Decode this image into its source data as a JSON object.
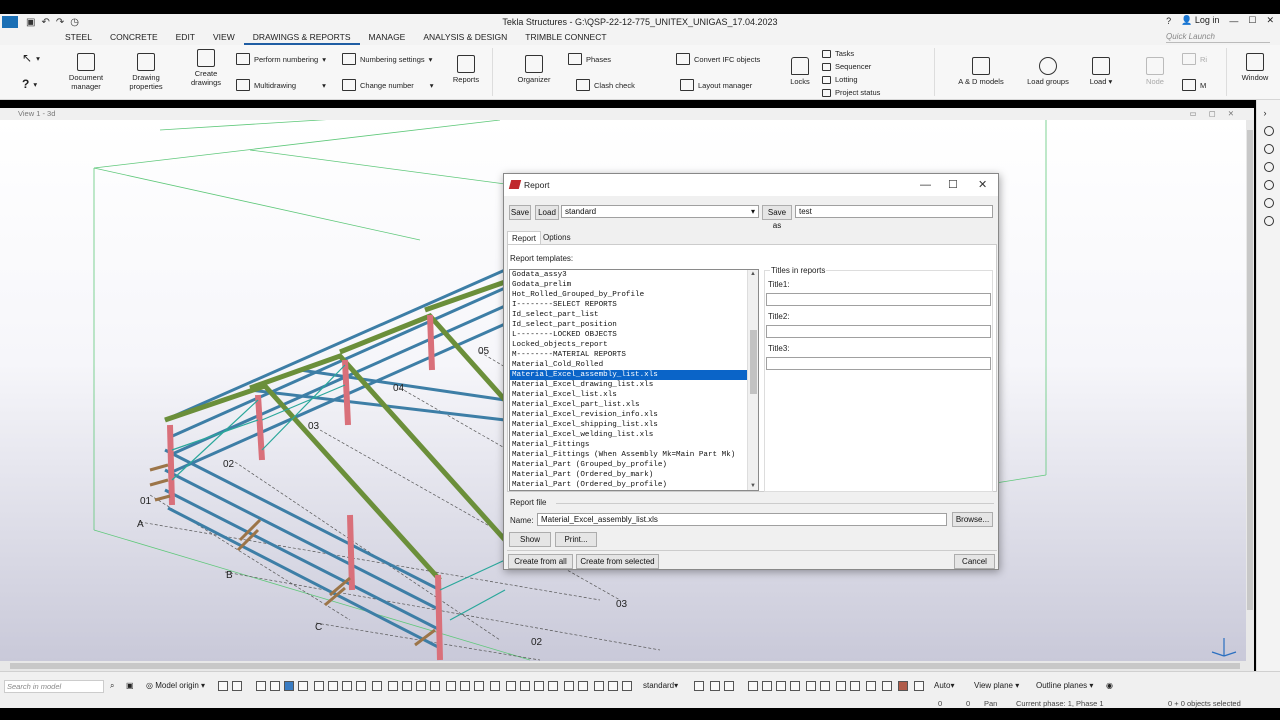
{
  "app": {
    "title": "Tekla Structures - G:\\QSP-22-12-775_UNITEX_UNIGAS_17.04.2023",
    "login_label": "Log in",
    "quick_launch_placeholder": "Quick Launch"
  },
  "tabs": [
    "STEEL",
    "CONCRETE",
    "EDIT",
    "VIEW",
    "DRAWINGS & REPORTS",
    "MANAGE",
    "ANALYSIS & DESIGN",
    "TRIMBLE CONNECT"
  ],
  "active_tab": "DRAWINGS & REPORTS",
  "ribbon": {
    "document_manager": "Document manager",
    "drawing_properties": "Drawing properties",
    "create_drawings": "Create drawings",
    "perform_numbering": "Perform numbering",
    "multidrawing": "Multidrawing",
    "numbering_settings": "Numbering settings",
    "change_number": "Change number",
    "reports": "Reports",
    "organizer": "Organizer",
    "phases": "Phases",
    "clash_check": "Clash check",
    "convert_ifc": "Convert IFC objects",
    "layout_manager": "Layout manager",
    "locks": "Locks",
    "tasks": "Tasks",
    "sequencer": "Sequencer",
    "lotting": "Lotting",
    "project_status": "Project status",
    "ad_models": "A & D models",
    "load_groups": "Load groups",
    "load": "Load",
    "node": "Node",
    "rigid": "Ri",
    "moment": "M",
    "window": "Window"
  },
  "view": {
    "title": "View 1 - 3d",
    "grid_labels": [
      "A",
      "B",
      "C",
      "01",
      "02",
      "03",
      "04",
      "05",
      "03",
      "02"
    ]
  },
  "dialog": {
    "title": "Report",
    "save": "Save",
    "load": "Load",
    "attr_set": "standard",
    "save_as": "Save as",
    "save_as_value": "test",
    "tab_report": "Report",
    "tab_options": "Options",
    "templates_label": "Report templates:",
    "templates": [
      "Godata_assy3",
      "Godata_prelim",
      "Hot_Rolled_Grouped_by_Profile",
      "I--------SELECT REPORTS",
      "Id_select_part_list",
      "Id_select_part_position",
      "L--------LOCKED OBJECTS",
      "Locked_objects_report",
      "M--------MATERIAL REPORTS",
      "Material_Cold_Rolled",
      "Material_Excel_assembly_list.xls",
      "Material_Excel_drawing_list.xls",
      "Material_Excel_list.xls",
      "Material_Excel_part_list.xls",
      "Material_Excel_revision_info.xls",
      "Material_Excel_shipping_list.xls",
      "Material_Excel_welding_list.xls",
      "Material_Fittings",
      "Material_Fittings (When Assembly Mk=Main Part Mk)",
      "Material_Part (Grouped_by_profile)",
      "Material_Part (Ordered_by_mark)",
      "Material_Part (Ordered_by_profile)"
    ],
    "selected_template": "Material_Excel_assembly_list.xls",
    "titles_group": "Titles in reports",
    "title1": "Title1:",
    "title2": "Title2:",
    "title3": "Title3:",
    "report_file": "Report file",
    "name_label": "Name:",
    "name_value": "Material_Excel_assembly_list.xls",
    "browse": "Browse...",
    "show": "Show",
    "print": "Print...",
    "create_all": "Create from all",
    "create_selected": "Create from selected",
    "cancel": "Cancel"
  },
  "statusbar": {
    "search_placeholder": "Search in model",
    "model_origin": "Model origin",
    "standard": "standard",
    "auto": "Auto",
    "view_plane": "View plane",
    "outline_planes": "Outline planes",
    "coord_x": "0",
    "coord_y": "0",
    "pan": "Pan",
    "current_phase": "Current phase: 1, Phase 1",
    "objects_selected": "0 + 0 objects selected"
  },
  "colors": {
    "accent": "#1f5da3",
    "selection": "#0a64c8",
    "columns": "#d9707a",
    "rafters": "#6b8f3a",
    "purlins": "#3d7ea6",
    "grid_lines": "#5fc87a"
  }
}
